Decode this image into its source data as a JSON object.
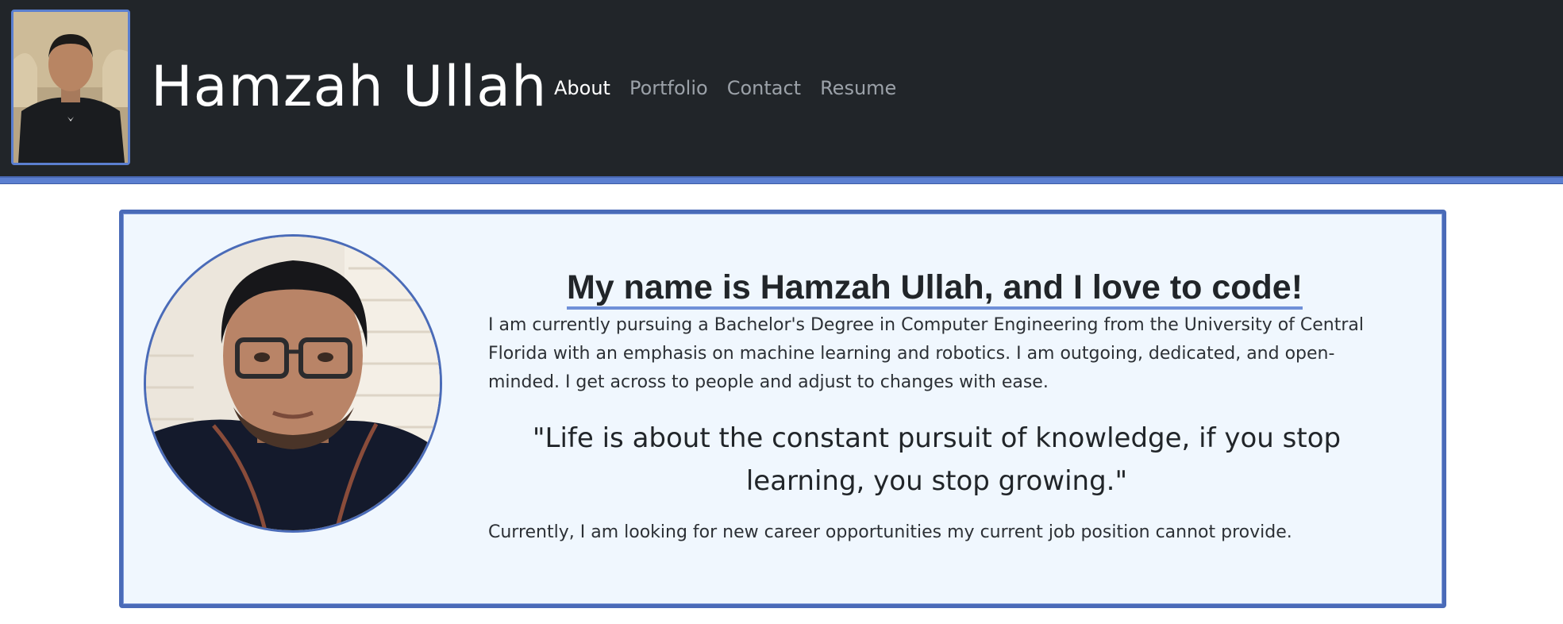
{
  "header": {
    "site_title": "Hamzah Ullah",
    "nav": [
      {
        "label": "About",
        "active": true
      },
      {
        "label": "Portfolio",
        "active": false
      },
      {
        "label": "Contact",
        "active": false
      },
      {
        "label": "Resume",
        "active": false
      }
    ]
  },
  "about": {
    "headline": "My name is Hamzah Ullah, and I love to code!",
    "bio": "I am currently pursuing a Bachelor's Degree in Computer Engineering from the University of Central Florida with an emphasis on machine learning and robotics. I am outgoing, dedicated, and open-minded. I get across to people and adjust to changes with ease.",
    "quote": "\"Life is about the constant pursuit of knowledge, if you stop learning, you stop growing.\"",
    "current": "Currently, I am looking for new career opportunities my current job position cannot provide."
  },
  "colors": {
    "header_bg": "#212529",
    "accent": "#5b7fd0",
    "card_bg": "#f0f7fe"
  }
}
